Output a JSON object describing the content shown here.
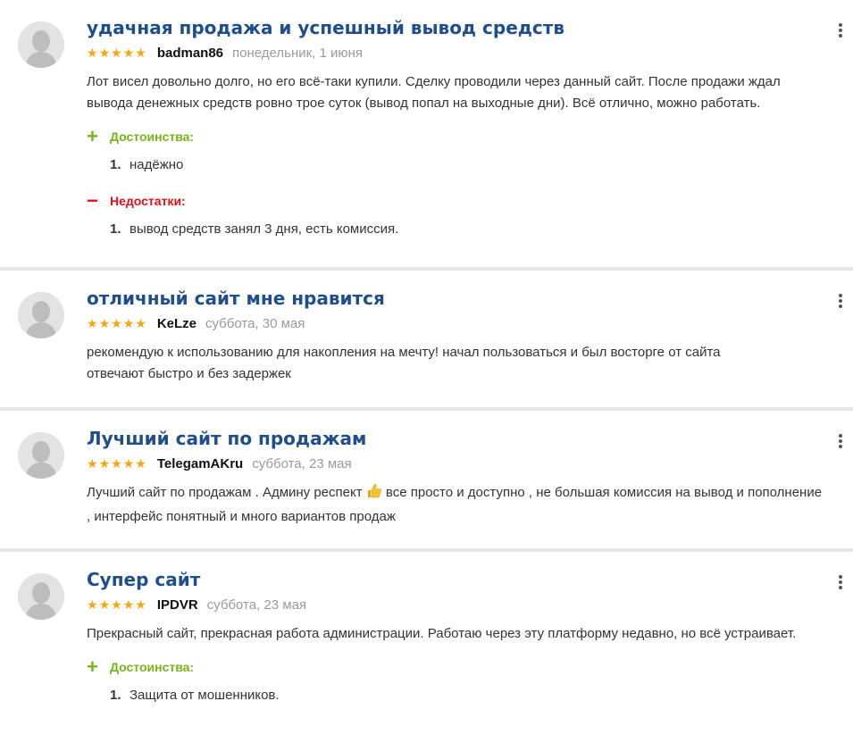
{
  "colors": {
    "title": "#1f4e8c",
    "star": "#f5a70c",
    "pros": "#7ab317",
    "cons": "#e0101a",
    "date": "#9a9a9a"
  },
  "icons": {
    "avatar": "user-avatar-icon",
    "menu": "kebab-menu-icon",
    "star": "star-icon",
    "plus": "plus-icon",
    "minus": "minus-icon",
    "thumb": "thumbs-up-icon"
  },
  "reviews": [
    {
      "title": "удачная продажа и успешный вывод средств",
      "rating": 5,
      "author": "badman86",
      "date": "понедельник, 1 июня",
      "text": "Лот висел довольно долго, но его всё-таки купили. Сделку проводили через данный сайт. После продажи ждал вывода денежных средств ровно трое суток (вывод попал на выходные дни). Всё отлично, можно работать.",
      "pros_label": "Достоинства:",
      "pros": [
        {
          "num": "1.",
          "text": "надёжно"
        }
      ],
      "cons_label": "Недостатки:",
      "cons": [
        {
          "num": "1.",
          "text": "вывод средств занял 3 дня, есть комиссия."
        }
      ]
    },
    {
      "title": "отличный сайт мне нравится",
      "rating": 5,
      "author": "KeLze",
      "date": "суббота, 30 мая",
      "text_line1": "рекомендую к использованию для накопления на мечту! начал пользоваться и был восторге от сайта",
      "text_line2": "отвечают быстро и без задержек"
    },
    {
      "title": "Лучший сайт по продажам",
      "rating": 5,
      "author": "TelegamAKru",
      "date": "суббота, 23 мая",
      "text_before": "Лучший сайт по продажам . Админу респект ",
      "text_after": " все просто и доступно , не большая комиссия на вывод и пополнение , интерфейс понятный и много вариантов продаж"
    },
    {
      "title": "Супер сайт",
      "rating": 5,
      "author": "IPDVR",
      "date": "суббота, 23 мая",
      "text": "Прекрасный сайт, прекрасная работа администрации. Работаю через эту платформу недавно, но всё устраивает.",
      "pros_label": "Достоинства:",
      "pros": [
        {
          "num": "1.",
          "text": "Защита от мошенников."
        }
      ]
    }
  ]
}
